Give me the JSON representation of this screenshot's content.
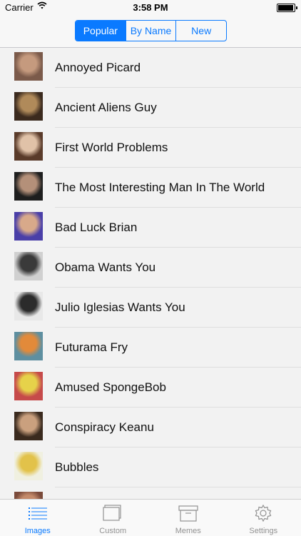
{
  "status_bar": {
    "carrier": "Carrier",
    "time": "3:58 PM",
    "battery_level": 0.95
  },
  "segments": [
    {
      "label": "Popular",
      "selected": true
    },
    {
      "label": "By Name",
      "selected": false
    },
    {
      "label": "New",
      "selected": false
    }
  ],
  "list": {
    "items": [
      {
        "label": "Annoyed Picard",
        "thumb": "picard-thumbnail",
        "thumb_colors": [
          "#7b5a4a",
          "#c59a7e"
        ]
      },
      {
        "label": "Ancient Aliens Guy",
        "thumb": "aliens-guy-thumbnail",
        "thumb_colors": [
          "#3b2a1e",
          "#b08a5a"
        ]
      },
      {
        "label": "First World Problems",
        "thumb": "first-world-problems-thumbnail",
        "thumb_colors": [
          "#5a3b2a",
          "#e0c2a8"
        ]
      },
      {
        "label": "The Most Interesting Man In The World",
        "thumb": "interesting-man-thumbnail",
        "thumb_colors": [
          "#1e1e1e",
          "#b49079"
        ]
      },
      {
        "label": "Bad Luck Brian",
        "thumb": "bad-luck-brian-thumbnail",
        "thumb_colors": [
          "#4a3fa8",
          "#d8a98a"
        ]
      },
      {
        "label": "Obama Wants You",
        "thumb": "obama-thumbnail",
        "thumb_colors": [
          "#d0d0d0",
          "#3a3a3a"
        ]
      },
      {
        "label": "Julio Iglesias Wants You",
        "thumb": "julio-iglesias-thumbnail",
        "thumb_colors": [
          "#e8e8e8",
          "#2b2b2b"
        ]
      },
      {
        "label": "Futurama Fry",
        "thumb": "futurama-fry-thumbnail",
        "thumb_colors": [
          "#5e8fa0",
          "#e28a3a"
        ]
      },
      {
        "label": "Amused SpongeBob",
        "thumb": "spongebob-thumbnail",
        "thumb_colors": [
          "#c64a4a",
          "#e6d24a"
        ]
      },
      {
        "label": "Conspiracy Keanu",
        "thumb": "conspiracy-keanu-thumbnail",
        "thumb_colors": [
          "#3a2a1e",
          "#caa07e"
        ]
      },
      {
        "label": "Bubbles",
        "thumb": "bubbles-thumbnail",
        "thumb_colors": [
          "#f0f0e0",
          "#e2c24a"
        ]
      },
      {
        "label": "",
        "thumb": "partial-thumbnail",
        "thumb_colors": [
          "#7a4a3a",
          "#c48a6a"
        ]
      }
    ]
  },
  "tabbar": {
    "tabs": [
      {
        "label": "Images",
        "icon": "list-icon",
        "active": true
      },
      {
        "label": "Custom",
        "icon": "stacked-pages-icon",
        "active": false
      },
      {
        "label": "Memes",
        "icon": "archive-box-icon",
        "active": false
      },
      {
        "label": "Settings",
        "icon": "gear-icon",
        "active": false
      }
    ]
  }
}
